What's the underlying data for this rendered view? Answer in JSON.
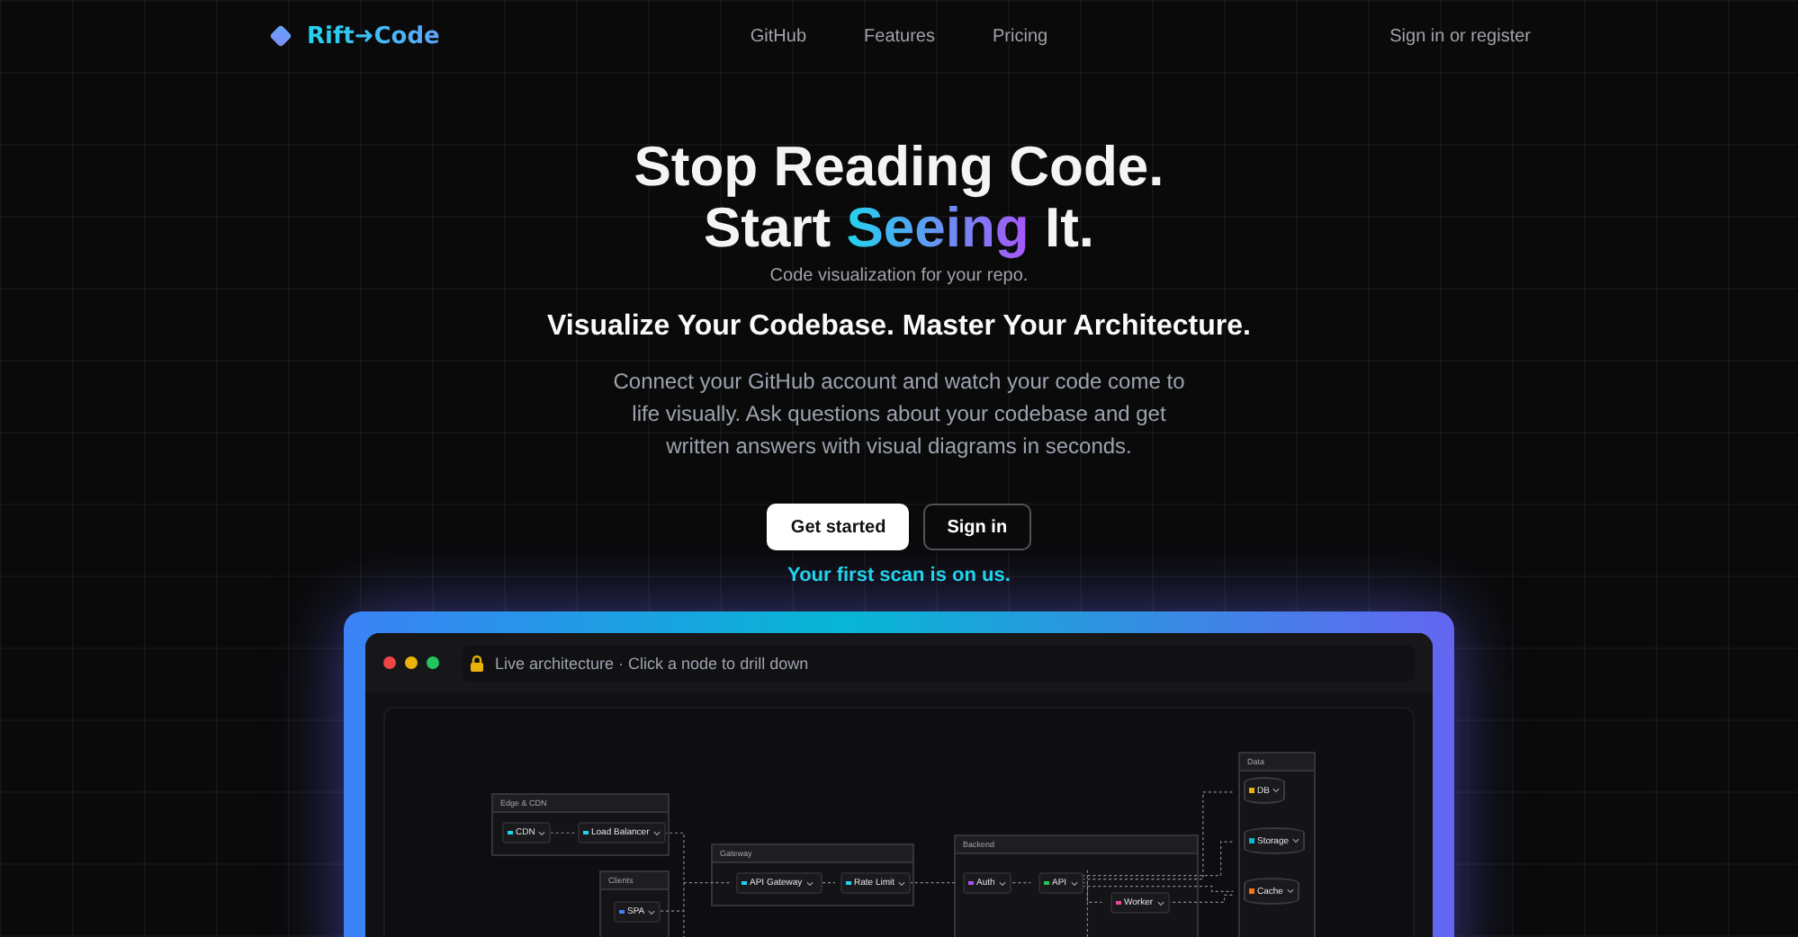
{
  "nav": {
    "brand": "Rift➜Code",
    "links": [
      {
        "label": "GitHub"
      },
      {
        "label": "Features"
      },
      {
        "label": "Pricing"
      }
    ],
    "account": "Sign in or register"
  },
  "hero": {
    "title_line_1": "Stop Reading Code.",
    "title_line_2": {
      "before": "Start ",
      "highlight": "Seeing",
      "after": " It."
    },
    "subtitle": "Code visualization for your repo.",
    "tagline": "Visualize Your Codebase. Master Your Architecture.",
    "description": "Connect your GitHub account and watch your code come to life visually. Ask questions about your codebase and get written answers with visual diagrams in seconds.",
    "buttons": [
      {
        "label": "Get started",
        "kind": "primary"
      },
      {
        "label": "Sign in",
        "kind": "outline"
      }
    ],
    "note": "Your first scan is on us."
  },
  "preview": {
    "address": "Live architecture · Click a node to drill down",
    "groups": [
      {
        "title": "Edge & CDN"
      },
      {
        "title": "Clients"
      },
      {
        "title": "Gateway"
      },
      {
        "title": "Backend"
      },
      {
        "title": "Data"
      }
    ],
    "nodes": [
      {
        "label": "CDN",
        "kind": "box",
        "color": "#22d3ee"
      },
      {
        "label": "Load Balancer",
        "kind": "box",
        "color": "#22d3ee"
      },
      {
        "label": "SPA",
        "kind": "box",
        "color": "#3b82f6"
      },
      {
        "label": "API Gateway",
        "kind": "box",
        "color": "#22d3ee"
      },
      {
        "label": "Rate Limit",
        "kind": "box",
        "color": "#22d3ee"
      },
      {
        "label": "Auth",
        "kind": "box",
        "color": "#a855f7"
      },
      {
        "label": "API",
        "kind": "box",
        "color": "#22c55e"
      },
      {
        "label": "Worker",
        "kind": "box",
        "color": "#ec4899"
      },
      {
        "label": "DB",
        "kind": "cylinder",
        "color": "#eab308"
      },
      {
        "label": "Storage",
        "kind": "cylinder",
        "color": "#06b6d4"
      },
      {
        "label": "Cache",
        "kind": "cylinder",
        "color": "#f97316"
      }
    ]
  }
}
